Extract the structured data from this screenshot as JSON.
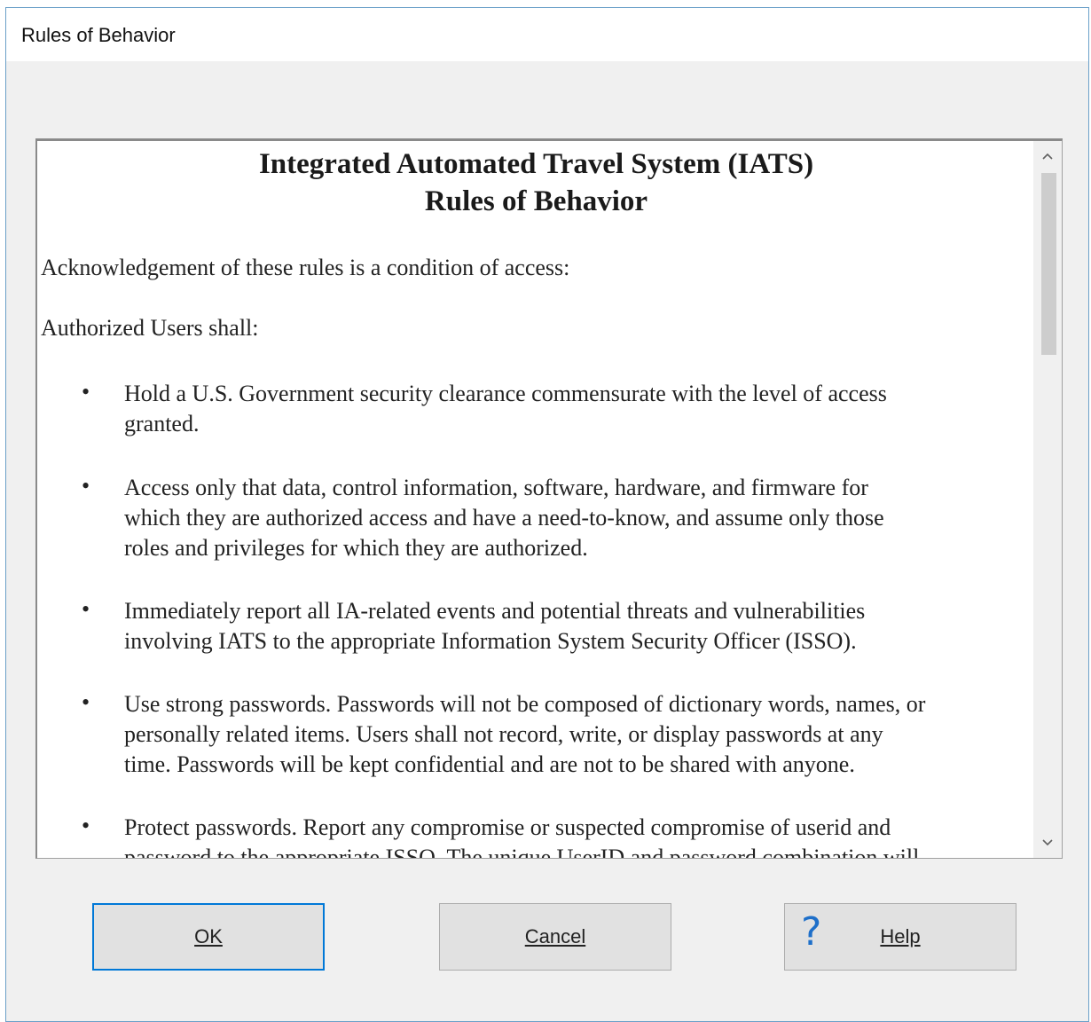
{
  "window": {
    "title": "Rules of Behavior"
  },
  "document": {
    "title_line1": "Integrated Automated Travel System (IATS)",
    "title_line2": "Rules of Behavior",
    "intro": "Acknowledgement of these rules is a condition of access:",
    "subhead": "Authorized Users shall:",
    "bullet_glyph": "•",
    "bullets": [
      {
        "line1": "Hold a U.S. Government security clearance commensurate with the level of access",
        "line2": "granted.",
        "line3": ""
      },
      {
        "line1": "Access only that data, control information, software, hardware, and firmware for",
        "line2": "which they are authorized access and have a need-to-know, and assume only those",
        "line3": "roles and privileges for which they are authorized."
      },
      {
        "line1": "Immediately report all IA-related events and potential threats and vulnerabilities",
        "line2": "involving IATS to the appropriate Information System Security Officer (ISSO).",
        "line3": ""
      },
      {
        "line1": "Use strong passwords. Passwords will not be composed of dictionary words, names, or",
        "line2": "personally related items. Users shall not record, write, or display passwords at any",
        "line3": "time. Passwords will be kept confidential and are not to be shared with anyone."
      },
      {
        "line1": "Protect passwords.  Report any compromise or suspected compromise of userid and",
        "line2": "password to the appropriate ISSO.  The unique UserID and password combination will",
        "line3": ""
      }
    ]
  },
  "scrollbar": {
    "up_icon": "chevron-up-icon",
    "down_icon": "chevron-down-icon",
    "up_glyph": "^",
    "down_glyph": "v",
    "position": 0.0
  },
  "buttons": {
    "ok_label": "OK",
    "cancel_label": "Cancel",
    "help_label": "Help",
    "help_glyph": "?"
  },
  "colors": {
    "accent": "#0078d7",
    "help_icon": "#1e6fc9",
    "dialog_bg": "#f0f0f0"
  }
}
